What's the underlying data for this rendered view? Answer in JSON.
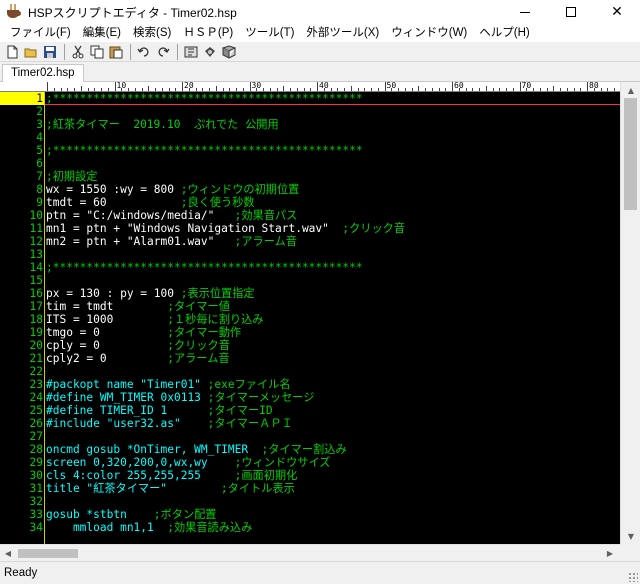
{
  "window": {
    "title": "HSPスクリプトエディタ - Timer02.hsp"
  },
  "menu": [
    {
      "label": "ファイル(F)"
    },
    {
      "label": "編集(E)"
    },
    {
      "label": "検索(S)"
    },
    {
      "label": "ＨＳＰ(P)"
    },
    {
      "label": "ツール(T)"
    },
    {
      "label": "外部ツール(X)"
    },
    {
      "label": "ウィンドウ(W)"
    },
    {
      "label": "ヘルプ(H)"
    }
  ],
  "toolbar": {
    "icons": [
      "new-file-icon",
      "open-folder-icon",
      "save-icon",
      "cut-icon",
      "copy-icon",
      "paste-icon",
      "undo-icon",
      "redo-icon",
      "run-icon",
      "settings-icon",
      "dictionary-icon"
    ]
  },
  "tabs": [
    {
      "label": "Timer02.hsp"
    }
  ],
  "ruler": {
    "labels": [
      "10",
      "20",
      "30",
      "40",
      "50",
      "60",
      "70",
      "80"
    ]
  },
  "editor": {
    "current_line": 1,
    "colors": {
      "background": "#000000",
      "line_number": "#00d000",
      "comment": "#00d000",
      "keyword": "#00ffff",
      "string": "#ffffff",
      "text": "#ffffff",
      "current_line_bg": "#ffff00"
    },
    "lines": [
      {
        "n": "1",
        "t": ";**********************************************",
        "c": "comment"
      },
      {
        "n": "2",
        "t": "",
        "c": "text"
      },
      {
        "n": "3",
        "t": ";紅茶タイマー  2019.10  ぷれでた 公開用",
        "c": "comment"
      },
      {
        "n": "4",
        "t": "",
        "c": "text"
      },
      {
        "n": "5",
        "t": ";**********************************************",
        "c": "comment"
      },
      {
        "n": "6",
        "t": "",
        "c": "text"
      },
      {
        "n": "7",
        "t": ";初期設定",
        "c": "comment"
      },
      {
        "n": "8",
        "t": "wx = 1550 :wy = 800 ;ウィンドウの初期位置",
        "c": "mixed"
      },
      {
        "n": "9",
        "t": "tmdt = 60           ;良く使う秒数",
        "c": "mixed"
      },
      {
        "n": "10",
        "t": "ptn = \"C:/windows/media/\"   ;効果音パス",
        "c": "mixed"
      },
      {
        "n": "11",
        "t": "mn1 = ptn + \"Windows Navigation Start.wav\"  ;クリック音",
        "c": "mixed"
      },
      {
        "n": "12",
        "t": "mn2 = ptn + \"Alarm01.wav\"   ;アラーム音",
        "c": "mixed"
      },
      {
        "n": "13",
        "t": "",
        "c": "text"
      },
      {
        "n": "14",
        "t": ";**********************************************",
        "c": "comment"
      },
      {
        "n": "15",
        "t": "",
        "c": "text"
      },
      {
        "n": "16",
        "t": "px = 130 : py = 100 ;表示位置指定",
        "c": "mixed"
      },
      {
        "n": "17",
        "t": "tim = tmdt        ;タイマー値",
        "c": "mixed"
      },
      {
        "n": "18",
        "t": "ITS = 1000        ;１秒毎に割り込み",
        "c": "mixed"
      },
      {
        "n": "19",
        "t": "tmgo = 0          ;タイマー動作",
        "c": "mixed"
      },
      {
        "n": "20",
        "t": "cply = 0          ;クリック音",
        "c": "mixed"
      },
      {
        "n": "21",
        "t": "cply2 = 0         ;アラーム音",
        "c": "mixed"
      },
      {
        "n": "22",
        "t": "",
        "c": "text"
      },
      {
        "n": "23",
        "t": "#packopt name \"Timer01\" ;exeファイル名",
        "c": "keyword"
      },
      {
        "n": "24",
        "t": "#define WM_TIMER 0x0113 ;タイマーメッセージ",
        "c": "keyword"
      },
      {
        "n": "25",
        "t": "#define TIMER_ID 1      ;タイマーID",
        "c": "keyword"
      },
      {
        "n": "26",
        "t": "#include \"user32.as\"    ;タイマーＡＰＩ",
        "c": "keyword"
      },
      {
        "n": "27",
        "t": "",
        "c": "text"
      },
      {
        "n": "28",
        "t": "oncmd gosub *OnTimer, WM_TIMER  ;タイマー割込み",
        "c": "keyword"
      },
      {
        "n": "29",
        "t": "screen 0,320,200,0,wx,wy    ;ウィンドウサイズ",
        "c": "keyword"
      },
      {
        "n": "30",
        "t": "cls 4:color 255,255,255     ;画面初期化",
        "c": "keyword"
      },
      {
        "n": "31",
        "t": "title \"紅茶タイマー\"        ;タイトル表示",
        "c": "keyword"
      },
      {
        "n": "32",
        "t": "",
        "c": "text"
      },
      {
        "n": "33",
        "t": "gosub *stbtn    ;ボタン配置",
        "c": "keyword"
      },
      {
        "n": "34",
        "t": "    mmload mn1,1  ;効果音読み込み",
        "c": "keyword"
      }
    ]
  },
  "status": {
    "text": "Ready"
  }
}
